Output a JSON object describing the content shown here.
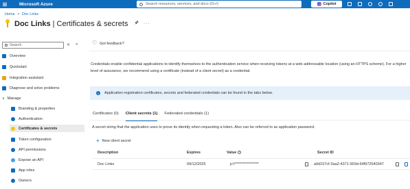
{
  "topbar": {
    "brand": "Microsoft Azure",
    "search_placeholder": "Search resources, services, and docs (G+/)",
    "copilot_label": "Copilot",
    "icons": [
      "terminal-icon",
      "notifications-icon",
      "settings-icon",
      "help-icon",
      "feedback-icon"
    ]
  },
  "breadcrumb": {
    "home": "Home",
    "separator": ">",
    "current": "Doc Links"
  },
  "page": {
    "title_name": "Doc Links",
    "title_section": " | Certificates & secrets"
  },
  "sidebar": {
    "search_placeholder": "Search",
    "items": [
      {
        "label": "Overview",
        "icon": "overview-icon",
        "color": "#0f6cbd"
      },
      {
        "label": "Quickstart",
        "icon": "quickstart-icon",
        "color": "#0f6cbd"
      },
      {
        "label": "Integration assistant",
        "icon": "rocket-icon",
        "color": "#e8a317"
      },
      {
        "label": "Diagnose and solve problems",
        "icon": "wrench-icon",
        "color": "#0f6cbd"
      },
      {
        "label": "Manage",
        "icon": "",
        "color": ""
      },
      {
        "label": "Branding & properties",
        "icon": "branding-icon",
        "color": "#0f6cbd"
      },
      {
        "label": "Authentication",
        "icon": "authentication-icon",
        "color": "#0f6cbd"
      },
      {
        "label": "Certificates & secrets",
        "icon": "key-icon",
        "color": "#f2c811"
      },
      {
        "label": "Token configuration",
        "icon": "token-icon",
        "color": "#0f6cbd"
      },
      {
        "label": "API permissions",
        "icon": "api-permissions-icon",
        "color": "#0f6cbd"
      },
      {
        "label": "Expose an API",
        "icon": "cloud-icon",
        "color": "#4aa0e6"
      },
      {
        "label": "App roles",
        "icon": "app-roles-icon",
        "color": "#0f6cbd"
      },
      {
        "label": "Owners",
        "icon": "owners-icon",
        "color": "#0f6cbd"
      }
    ]
  },
  "commandbar": {
    "feedback": "Got feedback?"
  },
  "content": {
    "description": "Credentials enable confidential applications to identify themselves to the authentication service when receiving tokens at a web addressable location (using an HTTPS scheme). For a higher level of assurance, we recommend using a certificate (instead of a client secret) as a credential.",
    "info_banner": "Application registration certificates, secrets and federated credentials can be found in the tabs below.",
    "tabs": [
      {
        "label": "Certificates (0)"
      },
      {
        "label": "Client secrets (1)"
      },
      {
        "label": "Federated credentials (1)"
      }
    ],
    "secrets_description": "A secret string that the application uses to prove its identity when requesting a token. Also can be referred to as application password.",
    "new_secret_label": "New client secret",
    "table": {
      "headers": [
        "Description",
        "Expires",
        "Value",
        "Secret ID"
      ],
      "rows": [
        {
          "description": "Doc Links",
          "expires": "09/12/2025",
          "value": "jcY****************",
          "secret_id": "a9d157cf-2aa2-4371-903d-64f972540347"
        }
      ]
    }
  }
}
